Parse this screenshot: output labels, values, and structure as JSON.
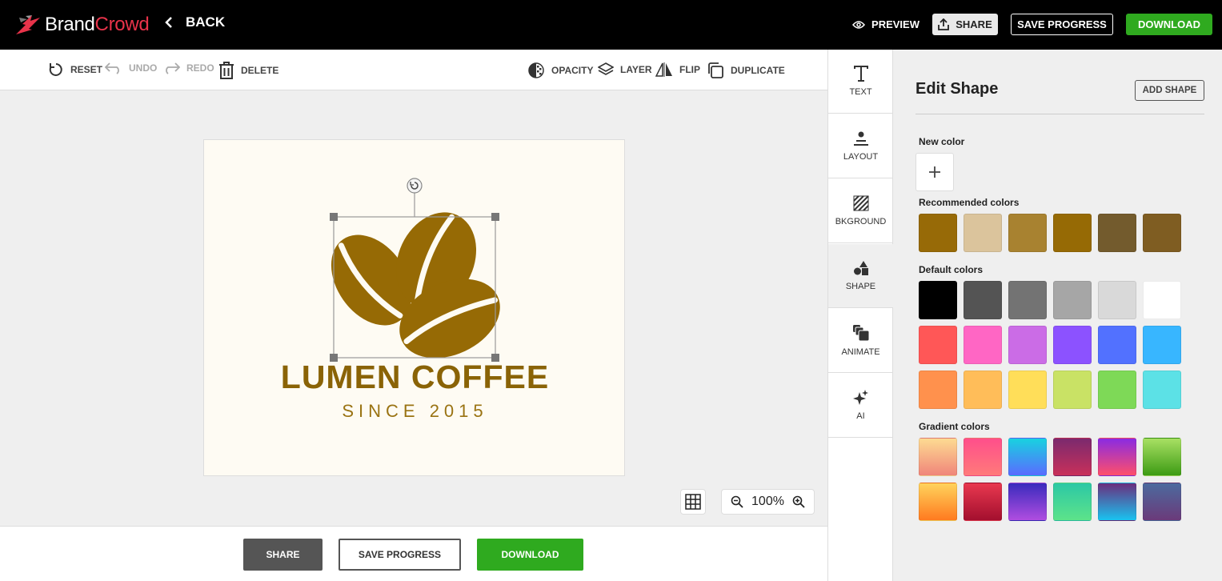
{
  "header": {
    "brand_part1": "Brand",
    "brand_part2": "Crowd",
    "back_label": "BACK",
    "preview_label": "PREVIEW",
    "share_label": "SHARE",
    "save_label": "SAVE PROGRESS",
    "download_label": "DOWNLOAD"
  },
  "toolbar": {
    "reset": "RESET",
    "undo": "UNDO",
    "redo": "REDO",
    "delete": "DELETE",
    "opacity": "OPACITY",
    "layer": "LAYER",
    "flip": "FLIP",
    "duplicate": "DUPLICATE"
  },
  "canvas": {
    "logo_title": "LUMEN COFFEE",
    "logo_subtitle": "SINCE 2015",
    "logo_color": "#966a05",
    "zoom_level": "100%"
  },
  "bottom": {
    "share_label": "SHARE",
    "save_label": "SAVE PROGRESS",
    "download_label": "DOWNLOAD"
  },
  "side_tabs": [
    {
      "label": "TEXT",
      "icon": "text-icon"
    },
    {
      "label": "LAYOUT",
      "icon": "layout-icon"
    },
    {
      "label": "BKGROUND",
      "icon": "background-icon"
    },
    {
      "label": "SHAPE",
      "icon": "shape-icon",
      "active": true
    },
    {
      "label": "ANIMATE",
      "icon": "animate-icon"
    },
    {
      "label": "AI",
      "icon": "sparkle-icon"
    }
  ],
  "panel": {
    "title": "Edit Shape",
    "add_shape_label": "ADD SHAPE",
    "new_color_label": "New color",
    "recommended_label": "Recommended colors",
    "default_label": "Default colors",
    "gradient_label": "Gradient colors",
    "recommended_colors": [
      "#976a07",
      "#dbc49c",
      "#a88230",
      "#966a05",
      "#735b2d",
      "#7f5d22"
    ],
    "default_colors": [
      "#000000",
      "#545454",
      "#737373",
      "#a6a6a6",
      "#d9d9d9",
      "#ffffff",
      "#ff5757",
      "#ff66c4",
      "#cb6ce6",
      "#8c52ff",
      "#5271ff",
      "#38b6ff",
      "#ff914d",
      "#ffbd59",
      "#ffde59",
      "#c9e265",
      "#7ed957",
      "#5ce1e6"
    ],
    "gradient_colors": [
      [
        "#fddb92",
        "#f0857a"
      ],
      [
        "#ff4f8b",
        "#ff7a7a"
      ],
      [
        "#18d2e0",
        "#5a6bff"
      ],
      [
        "#7b2a6e",
        "#c9305a"
      ],
      [
        "#8a2be2",
        "#ff4f6a"
      ],
      [
        "#a8e063",
        "#3d9b14"
      ],
      [
        "#ffd35c",
        "#ff7a1f"
      ],
      [
        "#e8384f",
        "#a30f2e"
      ],
      [
        "#3a2bbd",
        "#b04de0"
      ],
      [
        "#2cc8a5",
        "#5de38a"
      ],
      [
        "#6a2e7e",
        "#19c3f0"
      ],
      [
        "#4c6a9e",
        "#6b3a7a"
      ]
    ]
  }
}
